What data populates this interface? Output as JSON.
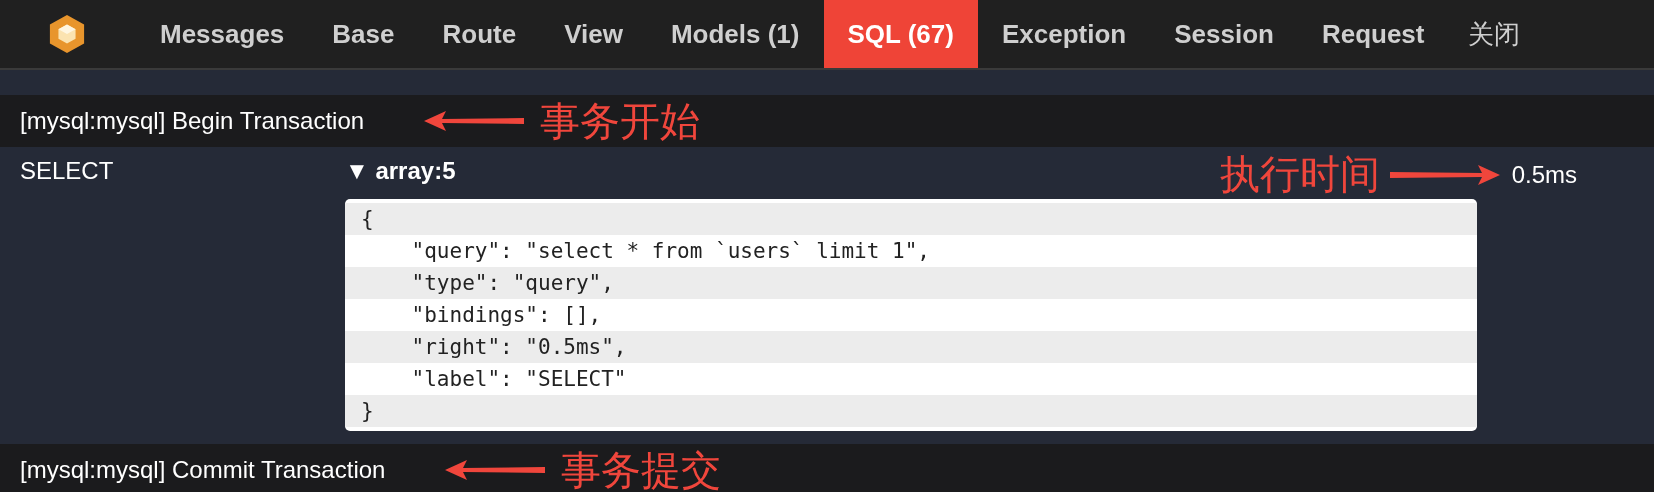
{
  "nav": {
    "tabs": [
      {
        "label": "Messages",
        "selected": false
      },
      {
        "label": "Base",
        "selected": false
      },
      {
        "label": "Route",
        "selected": false
      },
      {
        "label": "View",
        "selected": false
      },
      {
        "label": "Models (1)",
        "selected": false
      },
      {
        "label": "SQL (67)",
        "selected": true
      },
      {
        "label": "Exception",
        "selected": false
      },
      {
        "label": "Session",
        "selected": false
      },
      {
        "label": "Request",
        "selected": false
      }
    ],
    "close": "关闭"
  },
  "rows": [
    {
      "kind": "transaction",
      "text": "[mysql:mysql] Begin Transaction",
      "annotation": "事务开始"
    },
    {
      "kind": "query",
      "label": "SELECT",
      "toggle": "▼ array:5",
      "time": "0.5ms",
      "annotation": "执行时间",
      "code": [
        "{",
        "    \"query\": \"select * from `users` limit 1\",",
        "    \"type\": \"query\",",
        "    \"bindings\": [],",
        "    \"right\": \"0.5ms\",",
        "    \"label\": \"SELECT\"",
        "}"
      ]
    },
    {
      "kind": "transaction",
      "text": "[mysql:mysql] Commit Transaction",
      "annotation": "事务提交"
    }
  ]
}
